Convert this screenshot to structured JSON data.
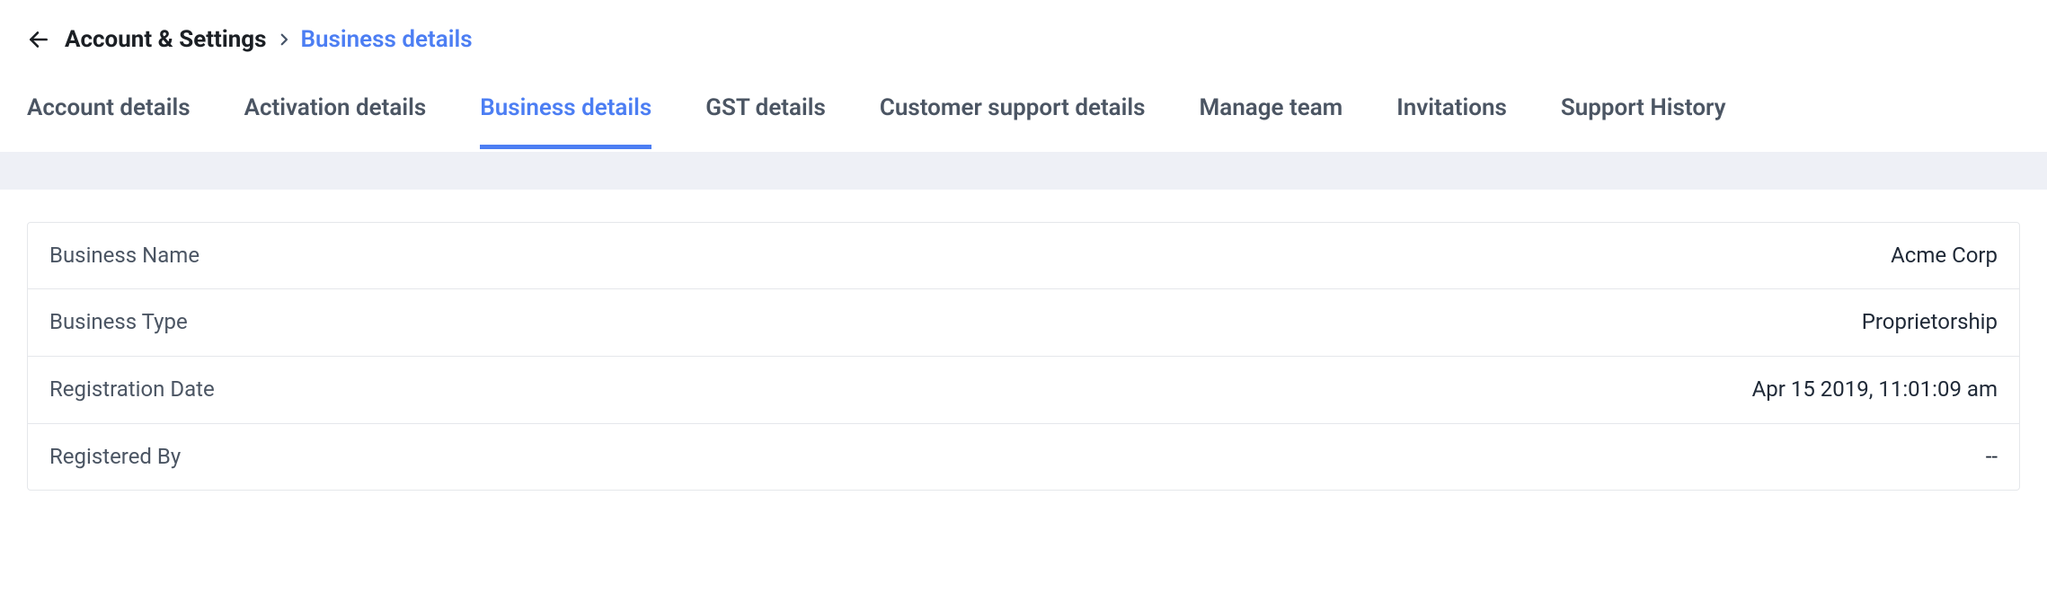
{
  "breadcrumb": {
    "parent": "Account & Settings",
    "current": "Business details"
  },
  "tabs": [
    {
      "label": "Account details",
      "active": false
    },
    {
      "label": "Activation details",
      "active": false
    },
    {
      "label": "Business details",
      "active": true
    },
    {
      "label": "GST details",
      "active": false
    },
    {
      "label": "Customer support details",
      "active": false
    },
    {
      "label": "Manage team",
      "active": false
    },
    {
      "label": "Invitations",
      "active": false
    },
    {
      "label": "Support History",
      "active": false
    }
  ],
  "details": [
    {
      "label": "Business Name",
      "value": "Acme Corp"
    },
    {
      "label": "Business Type",
      "value": "Proprietorship"
    },
    {
      "label": "Registration Date",
      "value": "Apr 15 2019, 11:01:09 am"
    },
    {
      "label": "Registered By",
      "value": "--"
    }
  ]
}
